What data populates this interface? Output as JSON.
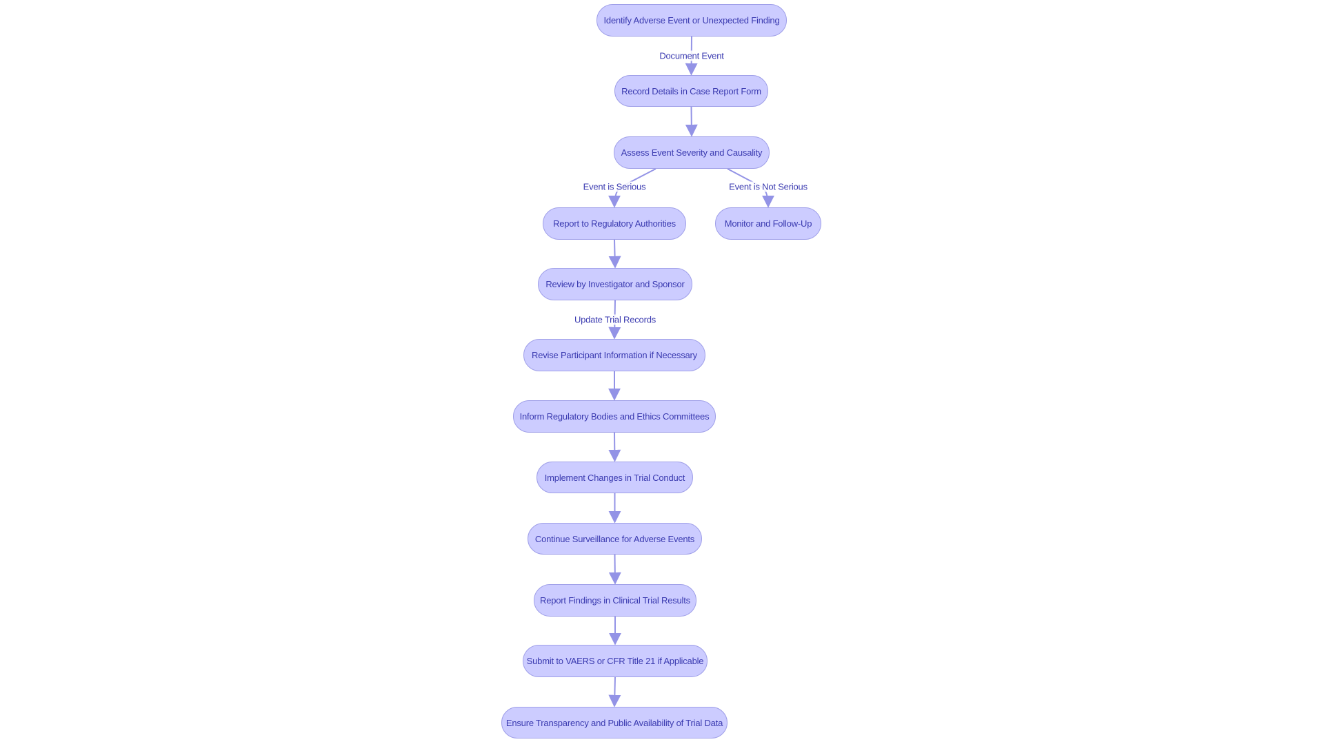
{
  "diagram": {
    "type": "flowchart",
    "colors": {
      "node_fill": "#ccccff",
      "node_border": "#9f9fe8",
      "edge": "#9393e6",
      "text": "#3a3ab0"
    },
    "nodes": [
      {
        "id": "identify",
        "label": "Identify Adverse Event or Unexpected Finding"
      },
      {
        "id": "record",
        "label": "Record Details in Case Report Form"
      },
      {
        "id": "assess",
        "label": "Assess Event Severity and Causality"
      },
      {
        "id": "report",
        "label": "Report to Regulatory Authorities"
      },
      {
        "id": "monitor",
        "label": "Monitor and Follow-Up"
      },
      {
        "id": "review",
        "label": "Review by Investigator and Sponsor"
      },
      {
        "id": "revise",
        "label": "Revise Participant Information if Necessary"
      },
      {
        "id": "inform",
        "label": "Inform Regulatory Bodies and Ethics Committees"
      },
      {
        "id": "implement",
        "label": "Implement Changes in Trial Conduct"
      },
      {
        "id": "continue",
        "label": "Continue Surveillance for Adverse Events"
      },
      {
        "id": "findings",
        "label": "Report Findings in Clinical Trial Results"
      },
      {
        "id": "submit",
        "label": "Submit to VAERS or CFR Title 21 if Applicable"
      },
      {
        "id": "ensure",
        "label": "Ensure Transparency and Public Availability of Trial Data"
      }
    ],
    "edges": [
      {
        "from": "identify",
        "to": "record",
        "label": "Document Event"
      },
      {
        "from": "record",
        "to": "assess",
        "label": ""
      },
      {
        "from": "assess",
        "to": "report",
        "label": "Event is Serious"
      },
      {
        "from": "assess",
        "to": "monitor",
        "label": "Event is Not Serious"
      },
      {
        "from": "report",
        "to": "review",
        "label": ""
      },
      {
        "from": "review",
        "to": "revise",
        "label": "Update Trial Records"
      },
      {
        "from": "revise",
        "to": "inform",
        "label": ""
      },
      {
        "from": "inform",
        "to": "implement",
        "label": ""
      },
      {
        "from": "implement",
        "to": "continue",
        "label": ""
      },
      {
        "from": "continue",
        "to": "findings",
        "label": ""
      },
      {
        "from": "findings",
        "to": "submit",
        "label": ""
      },
      {
        "from": "submit",
        "to": "ensure",
        "label": ""
      }
    ]
  }
}
